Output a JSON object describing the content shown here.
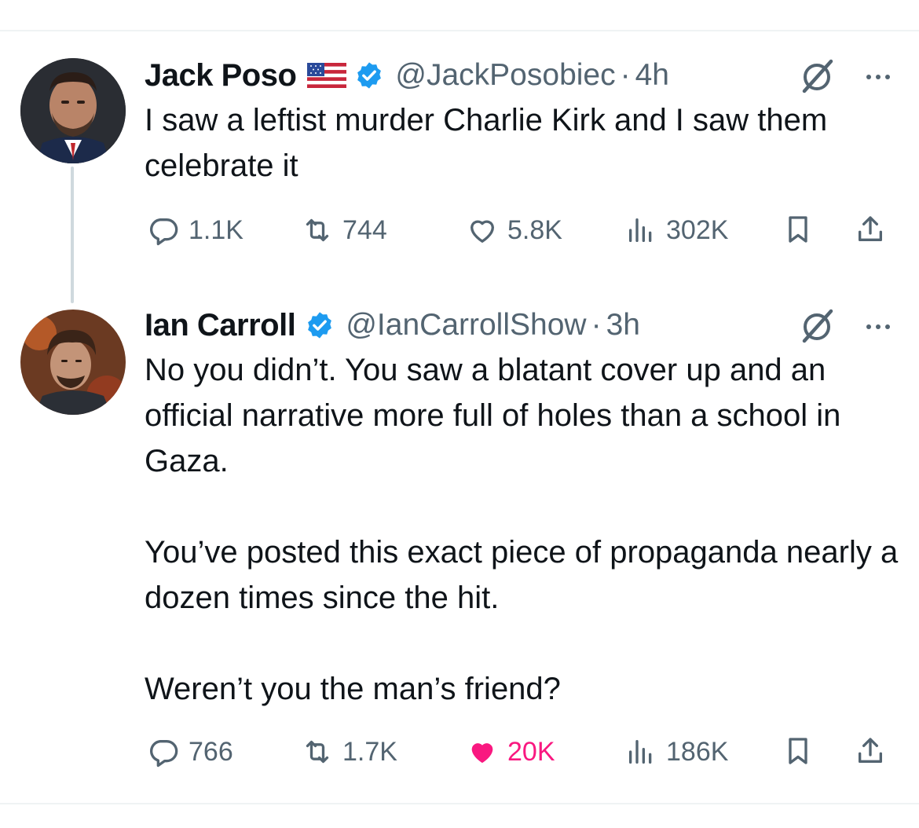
{
  "tweets": [
    {
      "name": "Jack Poso",
      "handle": "@JackPosobiec",
      "separator": "·",
      "time": "4h",
      "text": [
        "I saw a leftist murder Charlie Kirk and I saw them celebrate it"
      ],
      "replies": "1.1K",
      "reposts": "744",
      "likes": "5.8K",
      "views": "302K",
      "liked": false
    },
    {
      "name": "Ian Carroll",
      "handle": "@IanCarrollShow",
      "separator": "·",
      "time": "3h",
      "text": [
        "No you didn’t. You saw a blatant cover up and an official narrative more full of holes than a school in Gaza.",
        "You’ve posted this exact piece of propaganda nearly a dozen times since the hit.",
        "Weren’t you the man’s friend?"
      ],
      "replies": "766",
      "reposts": "1.7K",
      "likes": "20K",
      "views": "186K",
      "liked": true
    }
  ],
  "colors": {
    "text": "#0f1419",
    "secondary": "#536471",
    "verified": "#1d9bf0",
    "like": "#f91880",
    "thread_line": "#cfd9de"
  },
  "icons": [
    "flag-us-icon",
    "verified-badge-icon",
    "grok-icon",
    "more-icon",
    "reply-icon",
    "repost-icon",
    "like-icon",
    "views-icon",
    "bookmark-icon",
    "share-icon"
  ]
}
